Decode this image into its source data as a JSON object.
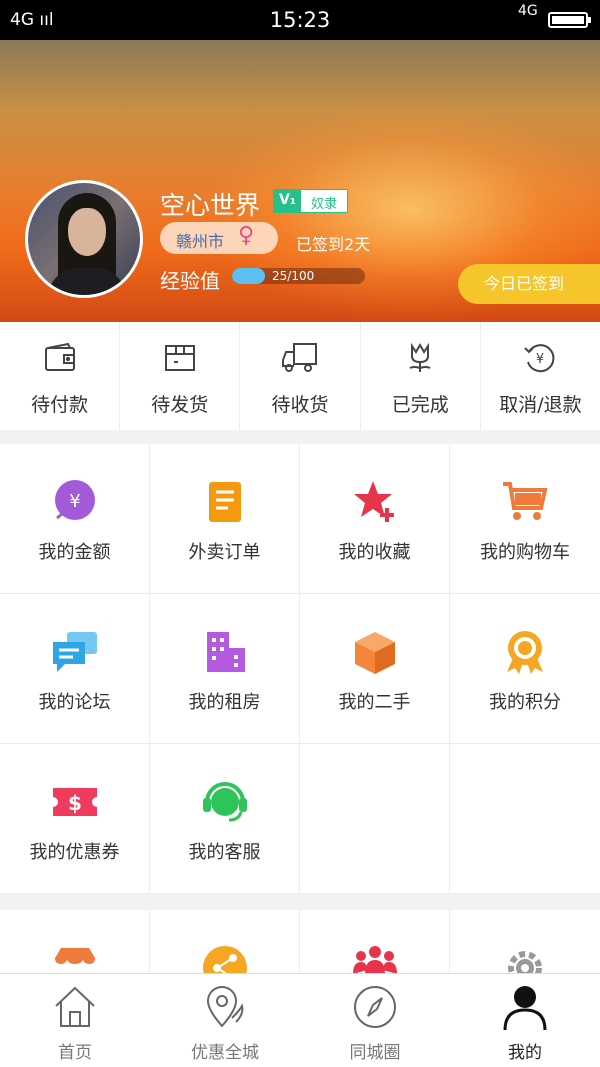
{
  "status_bar": {
    "signal": "4G ııl",
    "time": "15:23",
    "network": "4G"
  },
  "profile": {
    "username": "空心世界",
    "vip_badge": "V₁",
    "level_title": "奴隶",
    "city": "赣州市",
    "gender_symbol": "♀",
    "signed_text": "已签到2天",
    "exp_label": "经验值",
    "exp_text": "25/100",
    "exp_progress": 0.25,
    "checkin_label": "今日已签到"
  },
  "orders": [
    {
      "label": "待付款",
      "icon": "wallet-icon"
    },
    {
      "label": "待发货",
      "icon": "box-icon"
    },
    {
      "label": "待收货",
      "icon": "truck-icon"
    },
    {
      "label": "已完成",
      "icon": "flower-icon"
    },
    {
      "label": "取消/退款",
      "icon": "refund-icon"
    }
  ],
  "features": [
    {
      "label": "我的金额",
      "icon": "yuan-coin-icon",
      "color": "#a35ad6"
    },
    {
      "label": "外卖订单",
      "icon": "document-icon",
      "color": "#f59a10"
    },
    {
      "label": "我的收藏",
      "icon": "star-plus-icon",
      "color": "#e8344a"
    },
    {
      "label": "我的购物车",
      "icon": "cart-icon",
      "color": "#f07a3a"
    },
    {
      "label": "我的论坛",
      "icon": "chat-icon",
      "color": "#2ea6e6"
    },
    {
      "label": "我的租房",
      "icon": "building-icon",
      "color": "#b45ae0"
    },
    {
      "label": "我的二手",
      "icon": "cube-icon",
      "color": "#f3863a"
    },
    {
      "label": "我的积分",
      "icon": "medal-icon",
      "color": "#f5a623"
    },
    {
      "label": "我的优惠券",
      "icon": "coupon-icon",
      "color": "#ef3b5e"
    },
    {
      "label": "我的客服",
      "icon": "headset-icon",
      "color": "#2ec45a"
    }
  ],
  "partial_row": [
    {
      "icon": "shop-icon",
      "color": "#f07a3a"
    },
    {
      "icon": "share-icon",
      "color": "#f5a623"
    },
    {
      "icon": "group-icon",
      "color": "#e8344a"
    },
    {
      "icon": "settings-icon",
      "color": "#999999"
    }
  ],
  "tabbar": [
    {
      "label": "首页",
      "icon": "home-icon",
      "active": false
    },
    {
      "label": "优惠全城",
      "icon": "location-icon",
      "active": false
    },
    {
      "label": "同城圈",
      "icon": "compass-icon",
      "active": false
    },
    {
      "label": "我的",
      "icon": "person-icon",
      "active": true
    }
  ]
}
